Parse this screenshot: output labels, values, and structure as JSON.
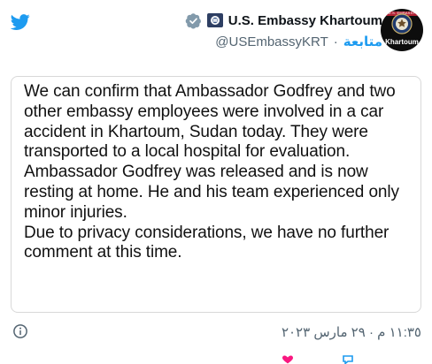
{
  "header": {
    "display_name": "U.S. Embassy Khartoum",
    "handle": "@USEmbassyKRT",
    "separator": "·",
    "follow_label": "متابعة"
  },
  "avatar": {
    "banner_text": "U.S. EMBASSY",
    "label": "Khartoum"
  },
  "statement": {
    "paragraphs": [
      "We can confirm that Ambassador Godfrey and two other embassy employees were involved in a car accident in Khartoum, Sudan today. They were transported to a local hospital for evaluation.",
      "Ambassador Godfrey was released and is now resting at home. He and his team experienced only minor injuries.",
      "Due to privacy considerations, we have no further comment at this time."
    ]
  },
  "footer": {
    "timestamp": "١١:٣٥ م · ٢٩ مارس ٢٠٢٣"
  },
  "icons": {
    "app": "twitter-bird-icon",
    "verified": "verified-badge-icon",
    "flag": "us-flag-icon",
    "info": "info-icon"
  },
  "colors": {
    "brand": "#1d9bf0",
    "verified": "#829aab",
    "secondary_text": "#536471"
  }
}
